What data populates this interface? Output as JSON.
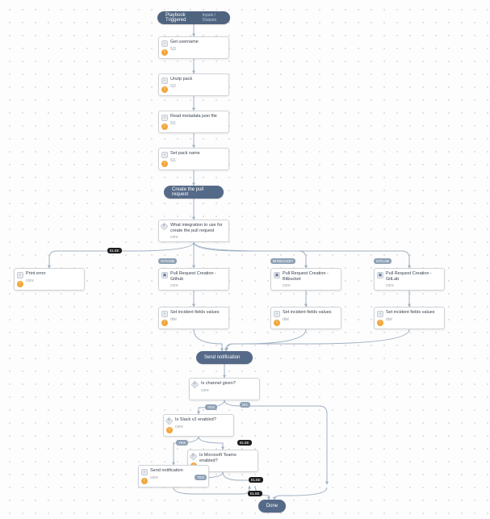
{
  "header": {
    "trigger": "Playbook Triggered",
    "trigger_sub": "Inputs / Outputs",
    "section_create": "Create the pull request",
    "section_notify": "Send notification",
    "done": "Done"
  },
  "tasks": {
    "get_username": {
      "title": "Get username",
      "sub": "5|3"
    },
    "unzip": {
      "title": "Unzip pack",
      "sub": "5|2"
    },
    "read_meta": {
      "title": "Read metadata json file",
      "sub": "5|1"
    },
    "set_pack": {
      "title": "Set pack name",
      "sub": "5|1"
    },
    "which_int": {
      "title": "What integration to use for create the pull request",
      "sub": "core"
    },
    "print_error": {
      "title": "Print error",
      "sub": "core"
    },
    "pr_github": {
      "title": "Pull Request Creation - Github",
      "sub": "core"
    },
    "pr_bitbucket": {
      "title": "Pull Request Creation - Bitbucket",
      "sub": "core"
    },
    "pr_gitlab": {
      "title": "Pull Request Creation - GitLab",
      "sub": "core"
    },
    "set_fields_1": {
      "title": "Set incident fields values",
      "sub": "dist"
    },
    "set_fields_2": {
      "title": "Set incident fields values",
      "sub": "dist"
    },
    "set_fields_3": {
      "title": "Set incident fields values",
      "sub": "dist"
    },
    "channel_given": {
      "title": "Is channel given?",
      "sub": "core"
    },
    "slack_enabled": {
      "title": "Is Slack v2 enabled?",
      "sub": "core"
    },
    "teams_enabled": {
      "title": "Is Microsoft Teams enabled?",
      "sub": "core"
    },
    "send_notif": {
      "title": "Send notification",
      "sub": "core"
    }
  },
  "branches": {
    "else": "ELSE",
    "github": "GITHUB",
    "bitbucket": "BITBUCKET",
    "gitlab": "GITLAB",
    "yes": "YES",
    "no": "NO"
  }
}
